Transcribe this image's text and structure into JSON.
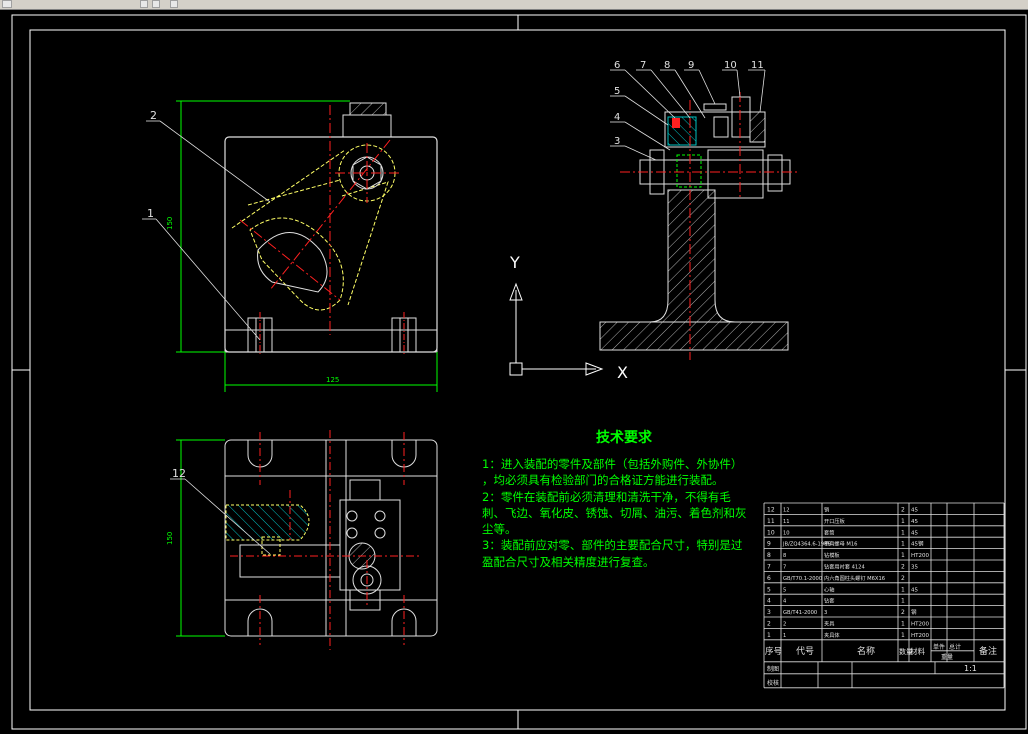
{
  "window": {
    "strip_icons": [
      "line-icon",
      "text-icon",
      "search-icon",
      "settings-icon"
    ]
  },
  "views": {
    "front": {
      "balloons": [
        "2",
        "1"
      ],
      "dim_height": "150",
      "dim_width": "125"
    },
    "side": {
      "balloons": [
        "6",
        "7",
        "8",
        "9",
        "10",
        "11",
        "5",
        "4",
        "3"
      ]
    },
    "top": {
      "balloons": [
        "12"
      ],
      "dim_height": "150"
    }
  },
  "ucs": {
    "x_label": "X",
    "y_label": "Y"
  },
  "tech_req": {
    "title": "技术要求",
    "lines": [
      "1：进入装配的零件及部件（包括外购件、外协件）",
      "，均必须具有检验部门的合格证方能进行装配。",
      "2：零件在装配前必须清理和清洗干净，不得有毛",
      "刺、飞边、氧化皮、锈蚀、切屑、油污、着色剂和灰",
      "尘等。",
      "3：装配前应对零、部件的主要配合尺寸，特别是过",
      "盈配合尺寸及相关精度进行复查。"
    ]
  },
  "bom": {
    "rows": [
      {
        "no": "12",
        "code": "12",
        "name": "销",
        "qty": "2",
        "mat": "45"
      },
      {
        "no": "11",
        "code": "11",
        "name": "开口压板",
        "qty": "1",
        "mat": "45"
      },
      {
        "no": "10",
        "code": "10",
        "name": "套筒",
        "qty": "1",
        "mat": "45"
      },
      {
        "no": "9",
        "code": "JB/ZQ4364.6-1986",
        "name": "带肩螺母 M16",
        "qty": "1",
        "mat": "45钢"
      },
      {
        "no": "8",
        "code": "8",
        "name": "钻模板",
        "qty": "1",
        "mat": "HT200"
      },
      {
        "no": "7",
        "code": "7",
        "name": "钻套用衬套 4124",
        "qty": "2",
        "mat": "35"
      },
      {
        "no": "6",
        "code": "GB/T70.1-2000",
        "name": "内六角圆柱头螺钉 M6X16",
        "qty": "2",
        "mat": ""
      },
      {
        "no": "5",
        "code": "5",
        "name": "心轴",
        "qty": "1",
        "mat": "45"
      },
      {
        "no": "4",
        "code": "4",
        "name": "钻套",
        "qty": "1",
        "mat": ""
      },
      {
        "no": "3",
        "code": "GB/T41-2000",
        "name": "3",
        "qty": "2",
        "mat": "钢"
      },
      {
        "no": "2",
        "code": "2",
        "name": "夹具",
        "qty": "1",
        "mat": "HT200"
      },
      {
        "no": "1",
        "code": "1",
        "name": "夹具体",
        "qty": "1",
        "mat": "HT200"
      }
    ],
    "header": {
      "no": "序号",
      "code": "代号",
      "name": "名称",
      "qty": "数量",
      "mat": "材料",
      "unit": "单件",
      "total": "总计",
      "weight": "重量",
      "remark": "备注"
    },
    "title_block": {
      "design": "制图",
      "check": "校核",
      "scale": "1:1"
    }
  },
  "colors": {
    "frame": "#ffffff",
    "outline": "#e0e0e0",
    "center": "#ff2020",
    "dim": "#00ff00",
    "hatch": "#00c0c0",
    "part": "#ffff66",
    "text": "#00ff00"
  }
}
